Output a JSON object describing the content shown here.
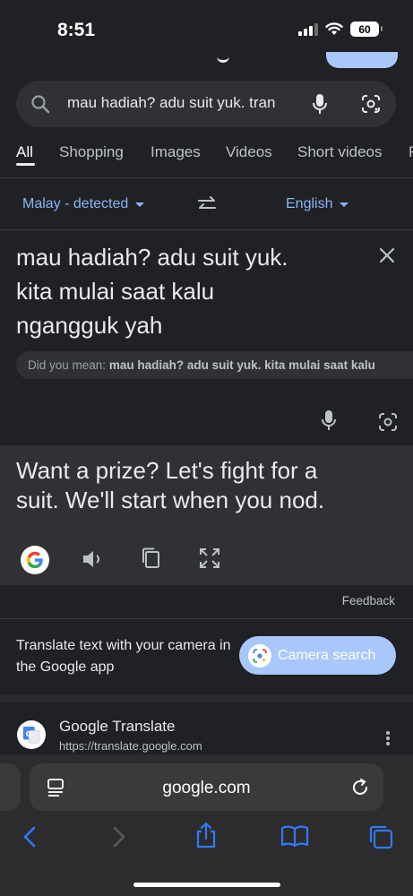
{
  "status": {
    "time": "8:51",
    "battery": "60"
  },
  "search": {
    "query": "mau hadiah? adu suit yuk. tran"
  },
  "tabs": [
    {
      "label": "All",
      "active": true
    },
    {
      "label": "Shopping"
    },
    {
      "label": "Images"
    },
    {
      "label": "Videos"
    },
    {
      "label": "Short videos"
    }
  ],
  "translate": {
    "source_lang": "Malay - detected",
    "target_lang": "English",
    "source_lines": [
      "mau hadiah? adu suit yuk.",
      "kita mulai saat kalu",
      "ngangguk yah"
    ],
    "did_you_mean_label": "Did you mean:",
    "did_you_mean_text": "mau hadiah? adu suit yuk. kita mulai saat kalu",
    "target_lines": [
      "Want a prize? Let's fight for a",
      "suit. We'll start when you nod."
    ],
    "feedback": "Feedback"
  },
  "camera_promo": {
    "text": "Translate text with your camera in the Google app",
    "button": "Camera search"
  },
  "result": {
    "title": "Google Translate",
    "url": "https://translate.google.com"
  },
  "browser": {
    "url": "google.com"
  },
  "colors": {
    "accent": "#8ab4f8",
    "button_bg": "#a8c7fa",
    "panel": "#303134",
    "background": "#202124"
  }
}
